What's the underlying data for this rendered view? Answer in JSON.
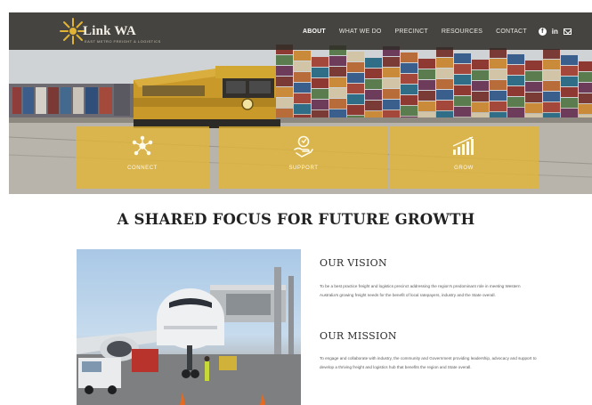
{
  "brand": {
    "name": "Link WA",
    "tagline": "EAST METRO FREIGHT & LOGISTICS",
    "accent_color": "#e2b435",
    "logo_icon": "sunburst-logo-icon"
  },
  "nav": {
    "items": [
      {
        "label": "ABOUT",
        "active": true
      },
      {
        "label": "WHAT WE DO",
        "active": false
      },
      {
        "label": "PRECINCT",
        "active": false
      },
      {
        "label": "RESOURCES",
        "active": false
      },
      {
        "label": "CONTACT",
        "active": false
      }
    ],
    "social": [
      {
        "icon": "facebook-icon",
        "glyph": "f"
      },
      {
        "icon": "linkedin-icon",
        "glyph": "in"
      },
      {
        "icon": "email-icon",
        "glyph": ""
      }
    ]
  },
  "hero": {
    "scene": "freight-train-container-yard",
    "features": [
      {
        "label": "CONNECT",
        "icon": "connect-icon"
      },
      {
        "label": "SUPPORT",
        "icon": "support-icon"
      },
      {
        "label": "GROW",
        "icon": "grow-icon"
      }
    ]
  },
  "main": {
    "heading": "A SHARED FOCUS FOR FUTURE GROWTH",
    "image": "airplane-at-gate-photo",
    "vision": {
      "title": "OUR VISION",
      "body": "To be a best practice freight and logistics precinct addressing the region's predominant role in meeting Western Australia's growing freight needs for the benefit of local ratepayers, industry and the State overall."
    },
    "mission": {
      "title": "OUR MISSION",
      "body": "To engage and collaborate with industry, the community and Government providing leadership, advocacy and support to develop a thriving freight and logistics hub that benefits the region and State overall."
    }
  }
}
